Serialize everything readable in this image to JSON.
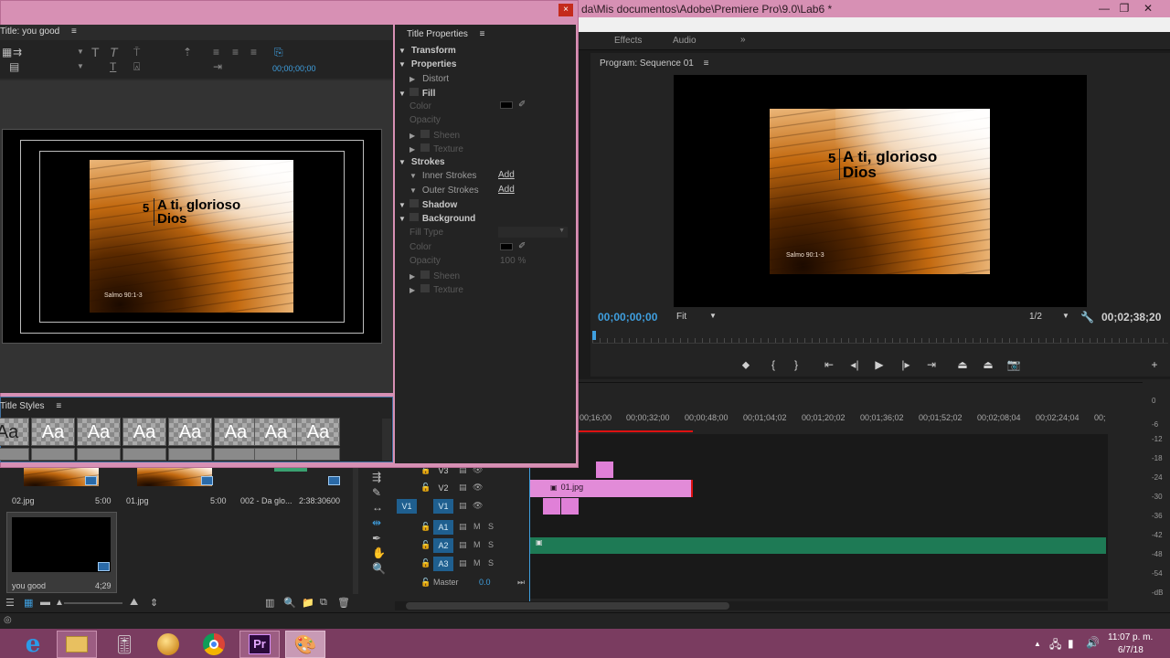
{
  "app": {
    "title": "da\\Mis documentos\\Adobe\\Premiere Pro\\9.0\\Lab6 *",
    "minimize_icon": "minimize-icon",
    "maximize_icon": "maximize-icon",
    "close_icon": "close-icon"
  },
  "tabs": [
    "Effects",
    "Audio",
    "»"
  ],
  "program": {
    "title": "Program: Sequence 01",
    "timecode": "00;00;00;00",
    "fit": "Fit",
    "resolution": "1/2",
    "duration": "00;02;38;20"
  },
  "poster": {
    "number": "5",
    "title_line1": "A ti, glorioso",
    "title_line2": "Dios",
    "footer": "Salmo 90:1-3"
  },
  "titler": {
    "header": "Title: you good",
    "timecode": "00;00;00;00",
    "close_label": "×",
    "styles_header": "Title Styles",
    "style_samples": [
      "Aa",
      "Aa",
      "Aa",
      "Aa",
      "Aa",
      "Aa",
      "Aa",
      "Aa"
    ]
  },
  "properties": {
    "header": "Title Properties",
    "transform": "Transform",
    "properties": "Properties",
    "distort": "Distort",
    "fill": "Fill",
    "color": "Color",
    "opacity": "Opacity",
    "sheen": "Sheen",
    "texture": "Texture",
    "strokes": "Strokes",
    "inner_strokes": "Inner Strokes",
    "outer_strokes": "Outer Strokes",
    "add": "Add",
    "shadow": "Shadow",
    "background": "Background",
    "fill_type": "Fill Type",
    "bg_color": "Color",
    "bg_opacity": "Opacity",
    "bg_opacity_value": "100 %",
    "bg_sheen": "Sheen",
    "bg_texture": "Texture"
  },
  "timeline": {
    "ruler": [
      "00;16;00",
      "00;00;32;00",
      "00;00;48;00",
      "00;01;04;02",
      "00;01;20;02",
      "00;01;36;02",
      "00;01;52;02",
      "00;02;08;04",
      "00;02;24;04",
      "00;"
    ],
    "tracks": {
      "v3": "V3",
      "v2": "V2",
      "v1_source": "V1",
      "v1": "V1",
      "a1": "A1",
      "a2": "A2",
      "a3": "A3",
      "master": "Master",
      "master_value": "0.0",
      "mute": "M",
      "solo": "S"
    },
    "clip_v2_label": "01.jpg"
  },
  "meter": [
    "0",
    "-6",
    "-12",
    "-18",
    "-24",
    "-30",
    "-36",
    "-42",
    "-48",
    "-54",
    "-dB"
  ],
  "project": {
    "items": [
      {
        "name": "02.jpg",
        "duration": "5:00"
      },
      {
        "name": "01.jpg",
        "duration": "5:00"
      },
      {
        "name": "002 - Da glo...",
        "duration": "2:38:30600"
      },
      {
        "name": "you good",
        "duration": "4;29"
      }
    ]
  },
  "taskbar": {
    "time": "11:07 p. m.",
    "date": "6/7/18",
    "premiere_label": "Pr"
  },
  "colors": {
    "accent": "#3f9fdf",
    "titlebar": "#d790b4",
    "clip_video": "#e28bd8",
    "clip_audio": "#1e7a55",
    "taskbar": "#7a3c60"
  }
}
